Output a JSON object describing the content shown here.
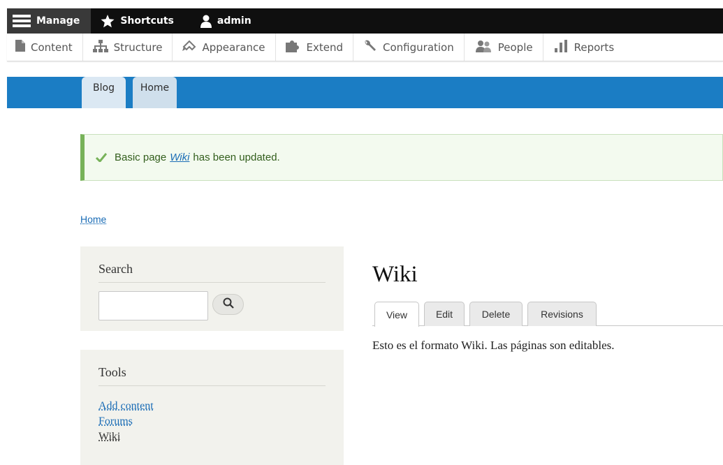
{
  "toolbar": {
    "manage_label": "Manage",
    "shortcuts_label": "Shortcuts",
    "user_label": "admin"
  },
  "tray": {
    "items": [
      {
        "label": "Content",
        "icon": "file-icon"
      },
      {
        "label": "Structure",
        "icon": "structure-icon"
      },
      {
        "label": "Appearance",
        "icon": "paint-icon"
      },
      {
        "label": "Extend",
        "icon": "puzzle-icon"
      },
      {
        "label": "Configuration",
        "icon": "wrench-icon"
      },
      {
        "label": "People",
        "icon": "people-icon"
      },
      {
        "label": "Reports",
        "icon": "bar-chart-icon"
      }
    ]
  },
  "primary_menu": {
    "tabs": [
      "Blog",
      "Home"
    ]
  },
  "status": {
    "prefix": "Basic page",
    "link": "Wiki",
    "suffix": "has been updated."
  },
  "breadcrumb": {
    "home": "Home"
  },
  "search_block": {
    "title": "Search",
    "input_value": ""
  },
  "tools_block": {
    "title": "Tools",
    "items": [
      "Add content",
      "Forums",
      "Wiki"
    ]
  },
  "page": {
    "title": "Wiki",
    "tabs": [
      "View",
      "Edit",
      "Delete",
      "Revisions"
    ],
    "body": "Esto es el formato Wiki. Las páginas son editables."
  },
  "colors": {
    "toolbar_bg": "#0f0f0f",
    "primary_band": "#1b7dc4",
    "status_border": "#77b259",
    "link": "#1b6db6"
  }
}
